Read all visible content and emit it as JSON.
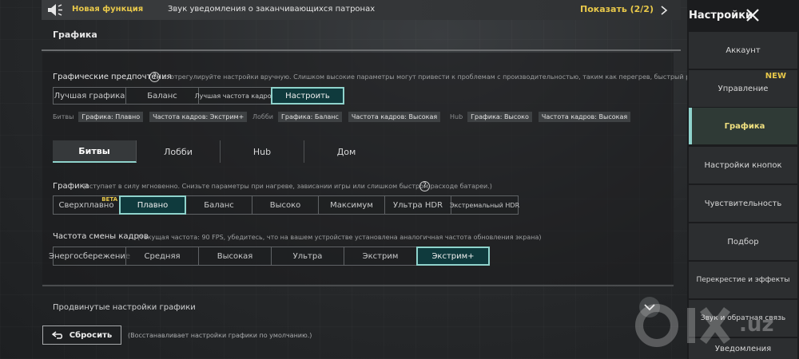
{
  "notification": {
    "new_feature": "Новая функция",
    "message": "Звук уведомления о заканчивающихся патронах",
    "show": "Показать (2/2)"
  },
  "section_title": "Графика",
  "preferences": {
    "title": "Графические предпочтения",
    "description": "е: отрегулируйте настройки вручную. Слишком высокие параметры могут привести к проблемам с производительностью, таким как перегрев, быстрый разряд батареи",
    "options": [
      "Лучшая графика",
      "Баланс",
      "Лучшая частота кадров",
      "Настроить"
    ],
    "selected": "Настроить"
  },
  "presets": [
    {
      "label": "Битвы",
      "tags": [
        "Графика: Плавно",
        "Частота кадров: Экстрим+"
      ]
    },
    {
      "label": "Лобби",
      "tags": [
        "Графика: Баланс",
        "Частота кадров: Высокая"
      ]
    },
    {
      "label": "Hub",
      "tags": [
        "Графика: Высоко",
        "Частота кадров: Высокая"
      ]
    }
  ],
  "tabs": [
    "Битвы",
    "Лобби",
    "Hub",
    "Дом"
  ],
  "active_tab": "Битвы",
  "graphics": {
    "title": "Графика",
    "description": "(вступает в силу мгновенно. Снизьте параметры при нагреве, зависании игры или слишком быстром расходе батареи.)",
    "options": [
      "Сверхплавно",
      "Плавно",
      "Баланс",
      "Высоко",
      "Максимум",
      "Ультра HDR",
      "Экстремальный HDR"
    ],
    "beta": "BETA",
    "selected": "Плавно"
  },
  "framerate": {
    "title": "Частота смены кадров",
    "description": "(текущая частота: 90 FPS, убедитесь, что на вашем устройстве установлена аналогичная частота обновления экрана)",
    "options": [
      "Энергосбережение",
      "Средняя",
      "Высокая",
      "Ультра",
      "Экстрим",
      "Экстрим+"
    ],
    "selected": "Экстрим+"
  },
  "advanced": "Продвинутые настройки графики",
  "reset": {
    "label": "Сбросить",
    "description": "(Восстанавливает настройки графики по умолчанию.)"
  },
  "sidebar": {
    "title": "Настройки",
    "items": [
      "Аккаунт",
      "Управление",
      "Графика",
      "Настройки кнопок",
      "Чувствительность",
      "Подбор",
      "Перекрестие и эффекты",
      "Звук и обратная связь",
      "Уведомления"
    ],
    "new_badge": "NEW",
    "active": "Графика"
  },
  "watermark": ".uz",
  "colors": {
    "accent": "#8fd3cc",
    "highlight": "#e8c84a",
    "selected_bg": "#0f3a3d"
  }
}
